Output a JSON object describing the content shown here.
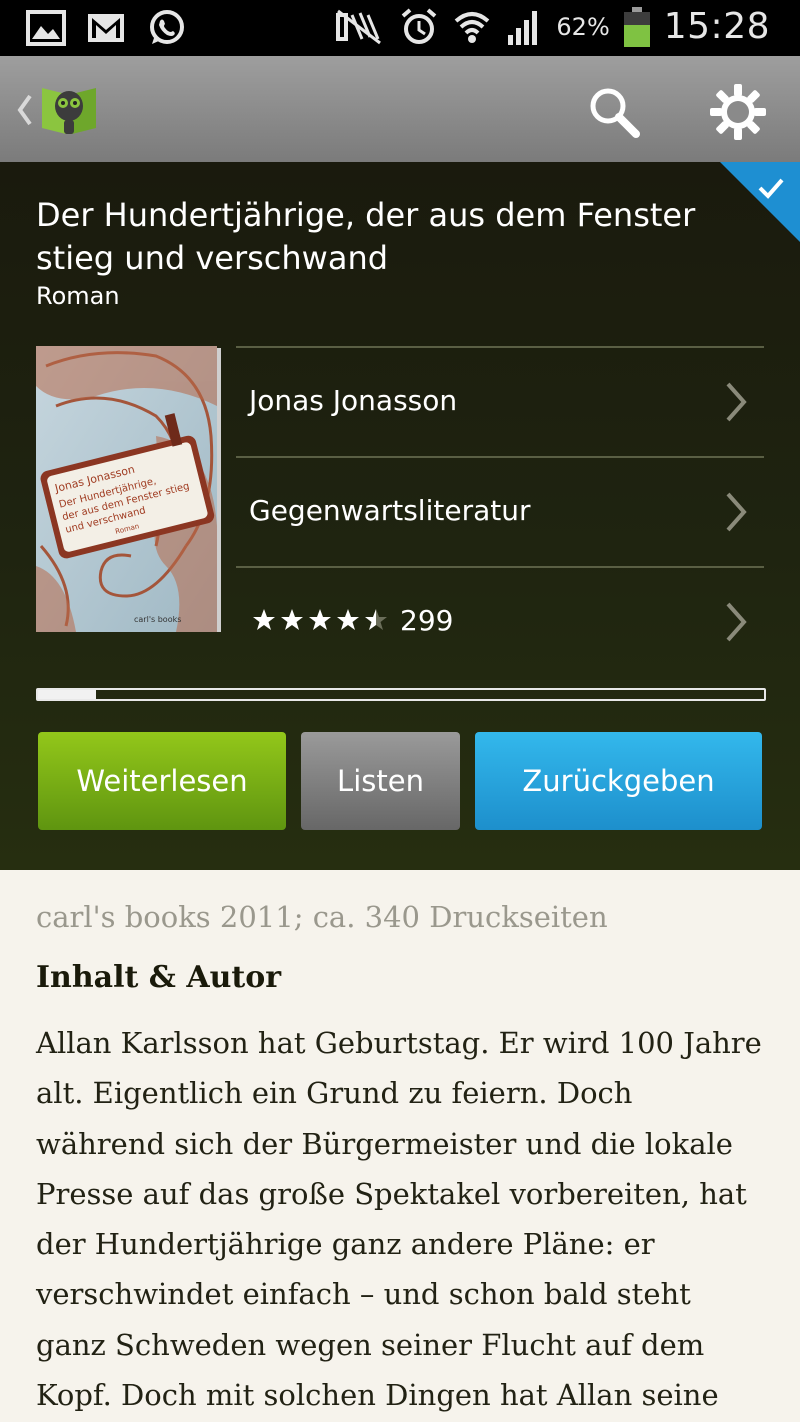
{
  "status_bar": {
    "left_icons": [
      "gallery-icon",
      "gmail-icon",
      "whatsapp-icon"
    ],
    "right_icons": [
      "nfc-icon",
      "alarm-icon",
      "wifi-icon",
      "signal-icon"
    ],
    "battery_percent": "62%",
    "battery_level": 0.62,
    "time": "15:28"
  },
  "action_bar": {
    "icons": [
      "back-chevron-icon",
      "app-logo-icon",
      "search-icon",
      "settings-icon"
    ]
  },
  "book": {
    "title": "Der Hundertjährige, der aus dem Fenster stieg und verschwand",
    "subtitle": "Roman",
    "cover": {
      "author": "Jonas Jonasson",
      "title_lines": [
        "Der Hundertjährige,",
        "der aus dem Fenster stieg",
        "und verschwand"
      ],
      "tag": "Roman",
      "publisher": "carl's books"
    },
    "author": "Jonas Jonasson",
    "category": "Gegenwartsliteratur",
    "rating_stars": 4.5,
    "rating_count": "299",
    "reading_progress": 0.08
  },
  "buttons": {
    "continue": "Weiterlesen",
    "listen": "Listen",
    "return": "Zurückgeben"
  },
  "colors": {
    "green": "#7cb315",
    "gray": "#7e7e7e",
    "blue": "#2aa6e0",
    "badge": "#1e8fd2"
  },
  "details": {
    "meta": "carl's books 2011; ca. 340 Druckseiten",
    "section_title": "Inhalt & Autor",
    "description_lines": [
      "Allan Karlsson hat Geburtstag. Er wird 100 Jahre",
      "alt. Eigentlich ein Grund zu feiern. Doch",
      "während sich der Bürgermeister und die lokale",
      "Presse auf das große Spektakel vorbereiten, hat",
      "der Hundertjährige ganz andere Pläne: er",
      "verschwindet einfach – und schon bald steht",
      "ganz Schweden wegen seiner Flucht auf dem",
      "Kopf. Doch mit solchen Dingen hat Allan seine"
    ]
  }
}
